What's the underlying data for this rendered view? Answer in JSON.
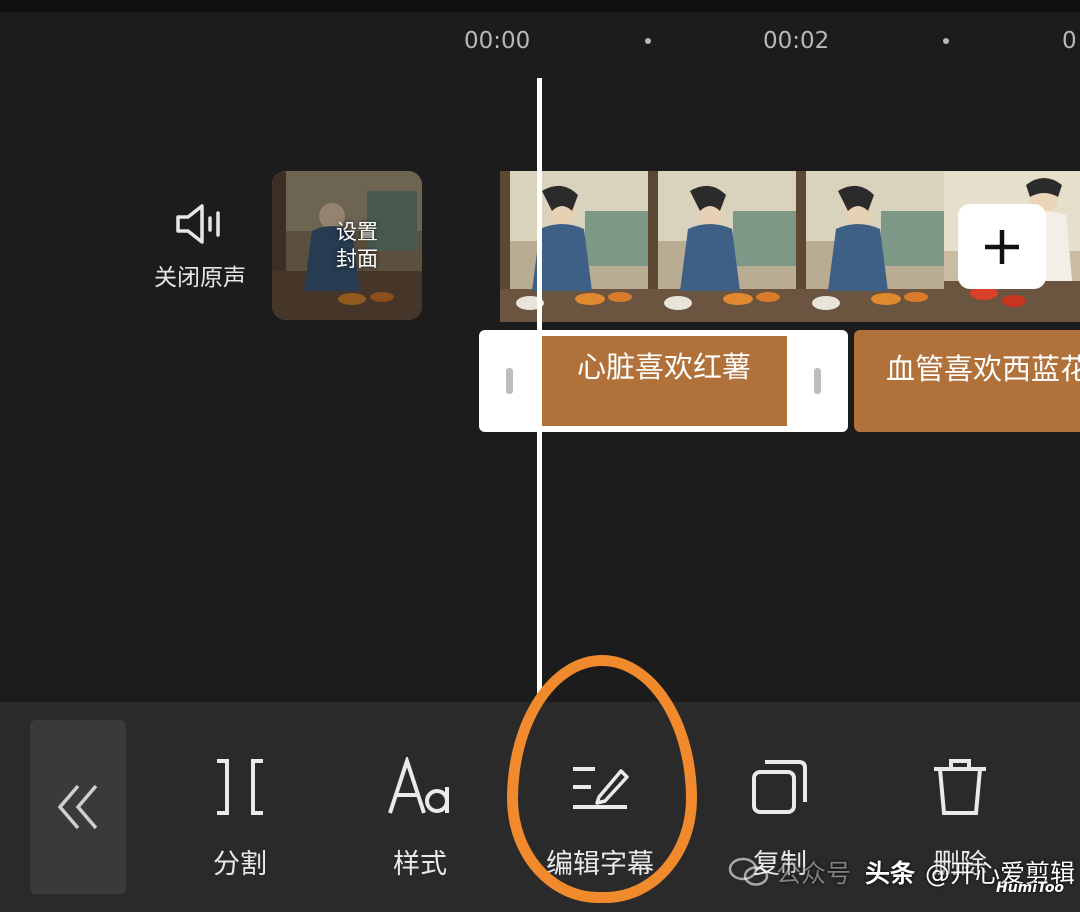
{
  "timeline": {
    "ruler": {
      "time_0": "00:00",
      "time_1": "00:02",
      "time_2": "0"
    },
    "mute_label": "关闭原声",
    "cover_label_1": "设置",
    "cover_label_2": "封面",
    "add_icon": "plus-icon"
  },
  "captions": {
    "clip_1": "心脏喜欢红薯",
    "clip_2": "血管喜欢西蓝花"
  },
  "toolbar": {
    "collapse_icon": "double-chevron-left-icon",
    "split": "分割",
    "style": "样式",
    "edit_caption": "编辑字幕",
    "copy": "复制",
    "delete": "删除"
  },
  "watermark": {
    "wechat_icon": "wechat-icon",
    "faded_text": "公众号",
    "platform": "头条",
    "handle": "@开心爱剪辑",
    "logo": "HumiToo"
  },
  "colors": {
    "background": "#1c1c1c",
    "toolbar": "#2a2a2a",
    "caption_fill": "#b0713a",
    "highlight_circle": "#f08a2c",
    "playhead": "#ffffff"
  }
}
